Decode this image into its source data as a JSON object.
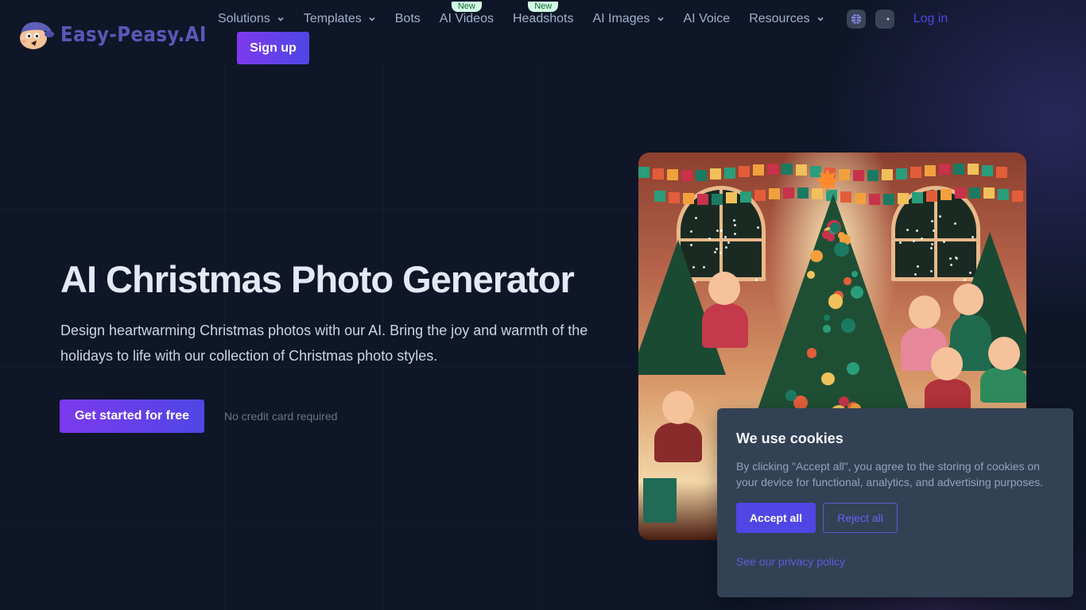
{
  "brand": {
    "name": "Easy-Peasy.AI",
    "accent": "#4f46e5",
    "gradient": [
      "#7c3aed",
      "#4f46e5"
    ]
  },
  "nav": {
    "items": [
      {
        "label": "Solutions",
        "dropdown": true,
        "badge": null
      },
      {
        "label": "Templates",
        "dropdown": true,
        "badge": null
      },
      {
        "label": "Bots",
        "dropdown": false,
        "badge": null
      },
      {
        "label": "AI Videos",
        "dropdown": false,
        "badge": "New"
      },
      {
        "label": "Headshots",
        "dropdown": false,
        "badge": "New"
      },
      {
        "label": "AI Images",
        "dropdown": true,
        "badge": null
      },
      {
        "label": "AI Voice",
        "dropdown": false,
        "badge": null
      },
      {
        "label": "Resources",
        "dropdown": true,
        "badge": null
      }
    ],
    "icons": [
      "globe-icon",
      "theme-toggle-icon"
    ],
    "login_label": "Log in",
    "signup_label": "Sign up"
  },
  "hero": {
    "title": "AI Christmas Photo Generator",
    "description": "Design heartwarming Christmas photos with our AI. Bring the joy and warmth of the holidays to life with our collection of Christmas photo styles.",
    "cta_label": "Get started for free",
    "cta_note": "No credit card required",
    "image_alt": "Illustration of children celebrating around a decorated Christmas tree"
  },
  "cookie_banner": {
    "title": "We use cookies",
    "text": "By clicking \"Accept all\", you agree to the storing of cookies on your device for functional, analytics, and advertising purposes.",
    "accept_label": "Accept all",
    "reject_label": "Reject all",
    "privacy_link": "See our privacy policy"
  }
}
